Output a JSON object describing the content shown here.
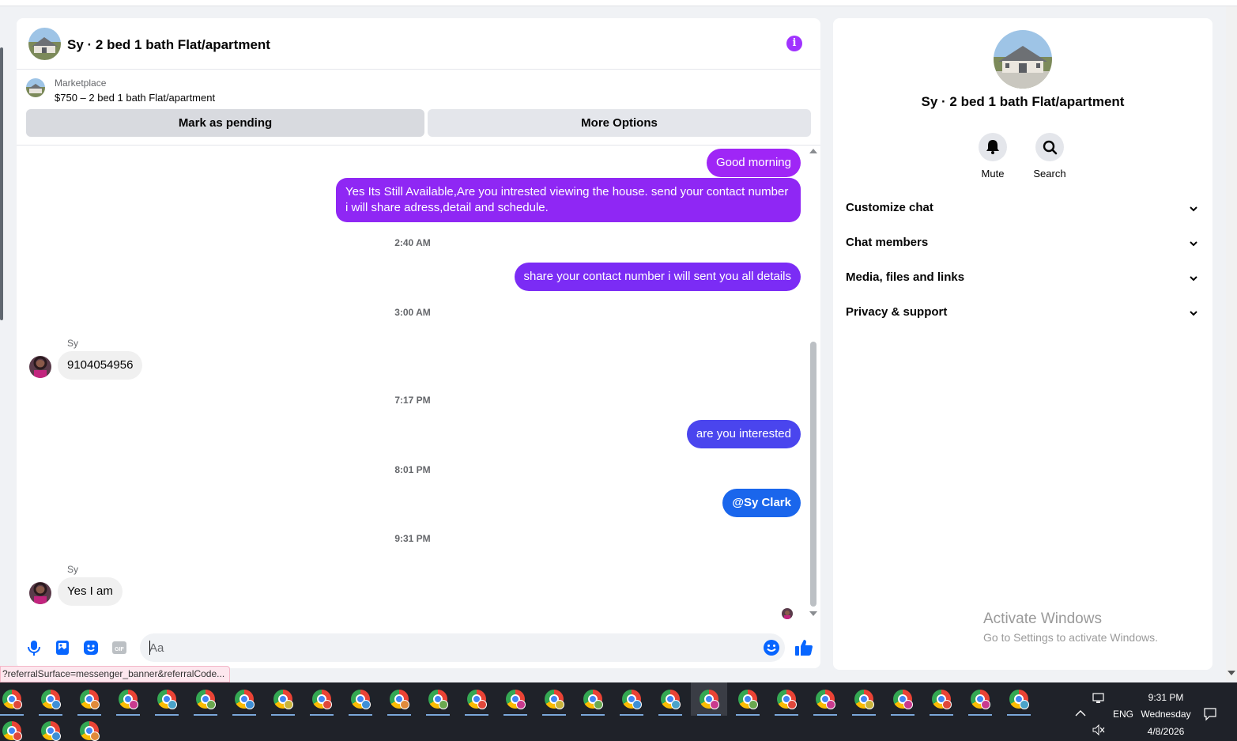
{
  "chat": {
    "title": "Sy · 2 bed 1 bath Flat/apartment",
    "info_icon": "info-icon",
    "marketplace": {
      "label": "Marketplace",
      "listing": "$750 – 2 bed 1 bath Flat/apartment",
      "mark_pending": "Mark as pending",
      "more_options": "More Options"
    },
    "messages": {
      "m1": "Good morning",
      "m2": "Yes Its Still Available,Are you intrested viewing the house. send your contact number i will share adress,detail and schedule.",
      "t1": "2:40 AM",
      "m3": "share your contact number i will sent you all details",
      "t2": "3:00 AM",
      "s1": "Sy",
      "m4": "9104054956",
      "t3": "7:17 PM",
      "m5": "are you interested",
      "t4": "8:01 PM",
      "m6": "@Sy Clark",
      "t5": "9:31 PM",
      "s2": "Sy",
      "m7": "Yes I am"
    },
    "colors": {
      "purple": "#9f26f6",
      "violet": "#7b2cf5",
      "indigo": "#4a45ee",
      "blue": "#1a66ec"
    },
    "composer": {
      "placeholder": "Aa"
    }
  },
  "status_url": "?referralSurface=messenger_banner&referralCode...",
  "info": {
    "title": "Sy · 2 bed 1 bath Flat/apartment",
    "mute": "Mute",
    "search": "Search",
    "sections": [
      "Customize chat",
      "Chat members",
      "Media, files and links",
      "Privacy & support"
    ]
  },
  "watermark": {
    "line1": "Activate Windows",
    "line2": "Go to Settings to activate Windows."
  },
  "taskbar": {
    "lang": "ENG",
    "time": "9:31 PM",
    "day": "Wednesday",
    "date": "4/8/2026"
  }
}
